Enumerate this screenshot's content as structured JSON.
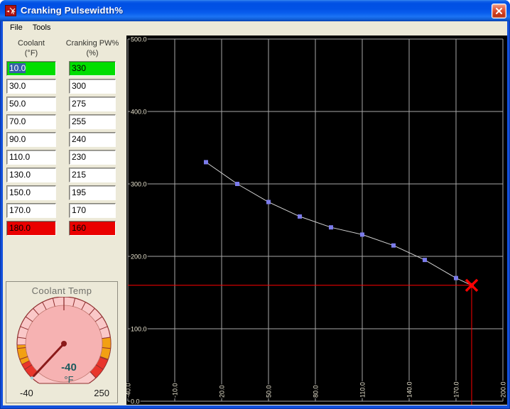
{
  "window": {
    "title": "Cranking Pulsewidth%",
    "accent_colors": {
      "titlebar_blue": "#0152E6",
      "border_blue": "#1250DC",
      "close_red": "#CC3A1C"
    }
  },
  "menu": {
    "items": [
      {
        "label": "File"
      },
      {
        "label": "Tools"
      }
    ]
  },
  "table": {
    "col1_header_line1": "Coolant",
    "col1_header_line2": "(°F)",
    "col2_header_line1": "Cranking PW%",
    "col2_header_line2": "(%)",
    "rows": [
      {
        "coolant": "10.0",
        "pw": "330",
        "state": "active"
      },
      {
        "coolant": "30.0",
        "pw": "300",
        "state": "normal"
      },
      {
        "coolant": "50.0",
        "pw": "275",
        "state": "normal"
      },
      {
        "coolant": "70.0",
        "pw": "255",
        "state": "normal"
      },
      {
        "coolant": "90.0",
        "pw": "240",
        "state": "normal"
      },
      {
        "coolant": "110.0",
        "pw": "230",
        "state": "normal"
      },
      {
        "coolant": "130.0",
        "pw": "215",
        "state": "normal"
      },
      {
        "coolant": "150.0",
        "pw": "195",
        "state": "normal"
      },
      {
        "coolant": "170.0",
        "pw": "170",
        "state": "normal"
      },
      {
        "coolant": "180.0",
        "pw": "160",
        "state": "limit"
      }
    ],
    "colors": {
      "active_bg": "#00DE00",
      "limit_bg": "#EA0000",
      "selection_bg": "#3560A8",
      "selection_fg": "#FFFFFF"
    }
  },
  "gauge": {
    "title": "Coolant Temp",
    "value": -40,
    "value_label": "-40",
    "units": "°F",
    "min": -40,
    "max": 250,
    "min_label": "-40",
    "max_label": "250",
    "face_color": "#F6B2B2",
    "rim_color": "#FAC8C8",
    "needle_color": "#8B1A1A",
    "value_color": "#1B5B5E",
    "outline_color": "#8F2F2F",
    "zones": [
      {
        "from": -40,
        "to": -18,
        "color": "#E8352C"
      },
      {
        "from": -18,
        "to": 8,
        "color": "#F2A013"
      },
      {
        "from": 192,
        "to": 222,
        "color": "#F2A013"
      },
      {
        "from": 222,
        "to": 250,
        "color": "#E8352C"
      }
    ]
  },
  "chart_data": {
    "type": "line",
    "title": "",
    "xlabel": "",
    "ylabel": "",
    "x": [
      10,
      30,
      50,
      70,
      90,
      110,
      130,
      150,
      170,
      180
    ],
    "y": [
      330,
      300,
      275,
      255,
      240,
      230,
      215,
      195,
      170,
      160
    ],
    "xlim": [
      -40,
      200
    ],
    "ylim": [
      0,
      500
    ],
    "xticks": [
      -40,
      -10,
      20,
      50,
      80,
      110,
      140,
      170,
      200
    ],
    "yticks": [
      0,
      100,
      200,
      300,
      400,
      500
    ],
    "xtick_labels": [
      "-40.0",
      "-10.0",
      "20.0",
      "50.0",
      "80.0",
      "110.0",
      "140.0",
      "170.0",
      "200.0"
    ],
    "ytick_labels": [
      "0.0",
      "100.0",
      "200.0",
      "300.0",
      "400.0",
      "500.0"
    ],
    "grid": true,
    "legend": null,
    "background": "#000000",
    "grid_color": "#A8A8A8",
    "line_color": "#D4D4D4",
    "marker_color": "#7B7BEB",
    "tick_label_color": "#E9E4D0",
    "cursor": {
      "x": 180,
      "y": 160,
      "color": "#FF0000"
    }
  }
}
